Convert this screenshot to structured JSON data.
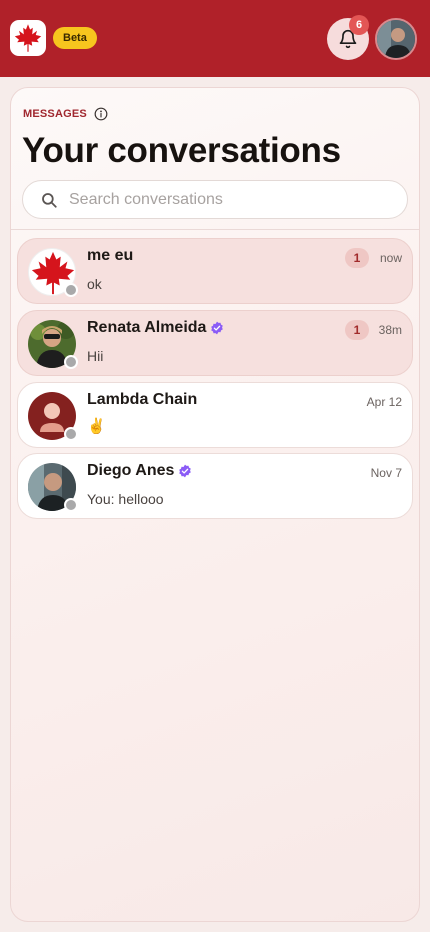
{
  "header": {
    "beta_label": "Beta",
    "notification_count": "6",
    "brand_color": "#b02129"
  },
  "section": {
    "label": "MESSAGES",
    "title": "Your conversations"
  },
  "search": {
    "placeholder": "Search conversations",
    "value": ""
  },
  "conversations": [
    {
      "name": "me eu",
      "message": "ok",
      "time": "now",
      "unread": "1",
      "verified": false,
      "avatar": "maple-leaf"
    },
    {
      "name": "Renata Almeida",
      "message": "Hii",
      "time": "38m",
      "unread": "1",
      "verified": true,
      "avatar": "photo"
    },
    {
      "name": "Lambda Chain",
      "message": "✌️",
      "time": "Apr 12",
      "unread": "",
      "verified": false,
      "avatar": "default-user"
    },
    {
      "name": "Diego Anes",
      "message": "You: hellooo",
      "time": "Nov 7",
      "unread": "",
      "verified": true,
      "avatar": "photo"
    }
  ]
}
